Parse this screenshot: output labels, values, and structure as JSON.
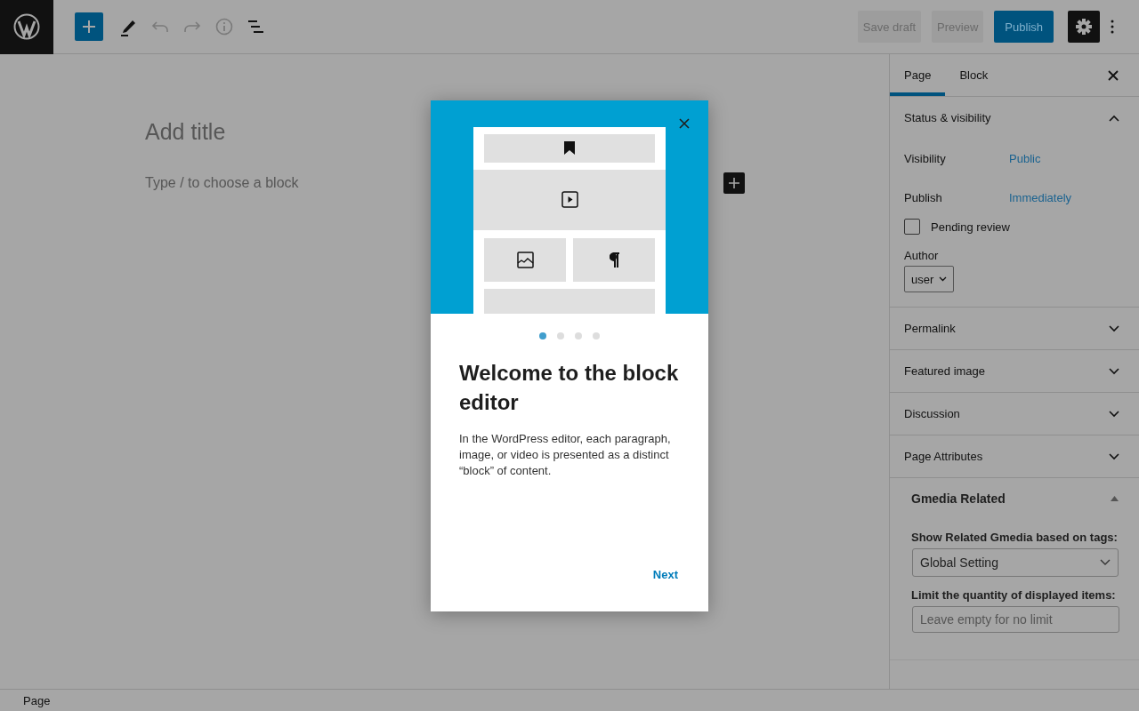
{
  "toolbar": {
    "save_draft": "Save draft",
    "preview": "Preview",
    "publish": "Publish"
  },
  "editor": {
    "title_placeholder": "Add title",
    "block_placeholder": "Type / to choose a block"
  },
  "guide": {
    "dots": [
      {
        "selected": true
      },
      {
        "selected": false
      },
      {
        "selected": false
      },
      {
        "selected": false
      }
    ],
    "heading": "Welcome to the block editor",
    "body": "In the WordPress editor, each paragraph, image, or video is presented as a distinct “block” of content.",
    "next": "Next"
  },
  "sidebar": {
    "tabs": [
      {
        "label": "Page",
        "selected": true
      },
      {
        "label": "Block",
        "selected": false
      }
    ],
    "panels": [
      {
        "title": "Status & visibility",
        "expanded": true
      },
      {
        "title": "Permalink",
        "expanded": false
      },
      {
        "title": "Featured image",
        "expanded": false
      },
      {
        "title": "Discussion",
        "expanded": false
      },
      {
        "title": "Page Attributes",
        "expanded": false
      }
    ],
    "status": {
      "rows": [
        {
          "label": "Visibility",
          "value": "Public"
        },
        {
          "label": "Publish",
          "value": "Immediately"
        }
      ],
      "pending": {
        "label": "Pending review",
        "checked": false
      },
      "author_label": "Author",
      "author": "user"
    },
    "metabox": {
      "title": "Gmedia Related",
      "expanded": true,
      "tags_label": "Show Related Gmedia based on tags:",
      "tags_value": "Global Setting",
      "limit_label": "Limit the quantity of displayed items:",
      "limit_placeholder": "Leave empty for no limit"
    }
  },
  "status_bar": {
    "breadcrumb": "Page"
  }
}
